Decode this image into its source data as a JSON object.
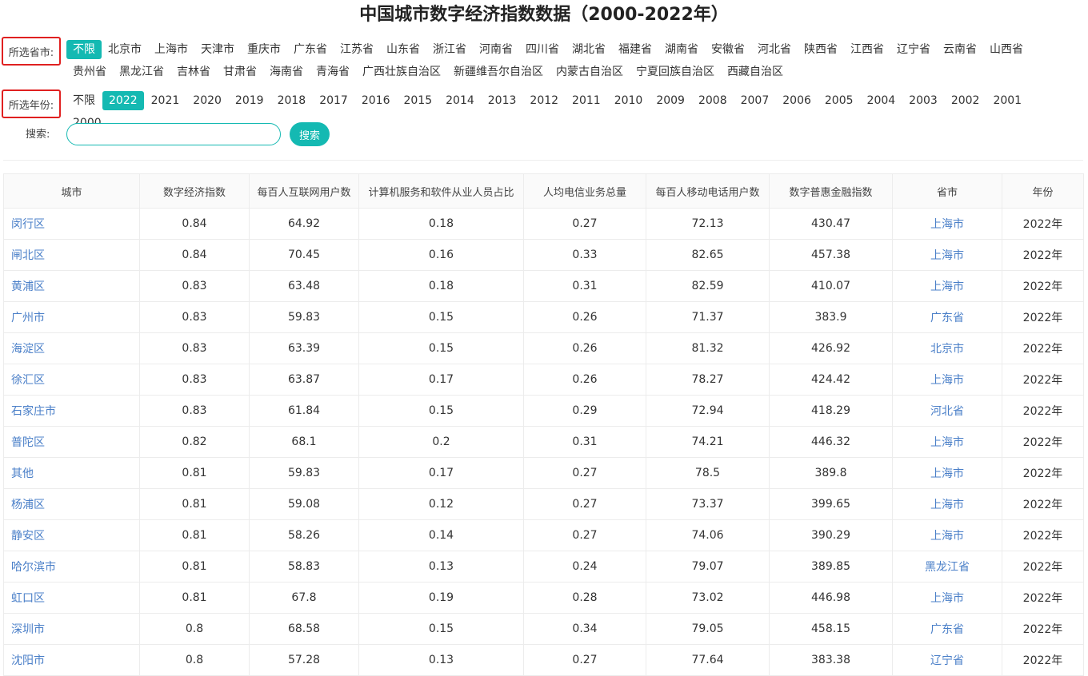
{
  "title": "中国城市数字经济指数数据（2000-2022年）",
  "province_filter": {
    "label": "所选省市:",
    "options": [
      "不限",
      "北京市",
      "上海市",
      "天津市",
      "重庆市",
      "广东省",
      "江苏省",
      "山东省",
      "浙江省",
      "河南省",
      "四川省",
      "湖北省",
      "福建省",
      "湖南省",
      "安徽省",
      "河北省",
      "陕西省",
      "江西省",
      "辽宁省",
      "云南省",
      "山西省",
      "贵州省",
      "黑龙江省",
      "吉林省",
      "甘肃省",
      "海南省",
      "青海省",
      "广西壮族自治区",
      "新疆维吾尔自治区",
      "内蒙古自治区",
      "宁夏回族自治区",
      "西藏自治区"
    ],
    "selected": "不限"
  },
  "year_filter": {
    "label": "所选年份:",
    "options": [
      "不限",
      "2022",
      "2021",
      "2020",
      "2019",
      "2018",
      "2017",
      "2016",
      "2015",
      "2014",
      "2013",
      "2012",
      "2011",
      "2010",
      "2009",
      "2008",
      "2007",
      "2006",
      "2005",
      "2004",
      "2003",
      "2002",
      "2001",
      "2000"
    ],
    "selected": "2022"
  },
  "search": {
    "label": "搜索:",
    "value": "",
    "button_label": "搜索"
  },
  "table": {
    "headers": [
      "城市",
      "数字经济指数",
      "每百人互联网用户数",
      "计算机服务和软件从业人员占比",
      "人均电信业务总量",
      "每百人移动电话用户数",
      "数字普惠金融指数",
      "省市",
      "年份"
    ],
    "rows": [
      [
        "闵行区",
        "0.84",
        "64.92",
        "0.18",
        "0.27",
        "72.13",
        "430.47",
        "上海市",
        "2022年"
      ],
      [
        "闸北区",
        "0.84",
        "70.45",
        "0.16",
        "0.33",
        "82.65",
        "457.38",
        "上海市",
        "2022年"
      ],
      [
        "黄浦区",
        "0.83",
        "63.48",
        "0.18",
        "0.31",
        "82.59",
        "410.07",
        "上海市",
        "2022年"
      ],
      [
        "广州市",
        "0.83",
        "59.83",
        "0.15",
        "0.26",
        "71.37",
        "383.9",
        "广东省",
        "2022年"
      ],
      [
        "海淀区",
        "0.83",
        "63.39",
        "0.15",
        "0.26",
        "81.32",
        "426.92",
        "北京市",
        "2022年"
      ],
      [
        "徐汇区",
        "0.83",
        "63.87",
        "0.17",
        "0.26",
        "78.27",
        "424.42",
        "上海市",
        "2022年"
      ],
      [
        "石家庄市",
        "0.83",
        "61.84",
        "0.15",
        "0.29",
        "72.94",
        "418.29",
        "河北省",
        "2022年"
      ],
      [
        "普陀区",
        "0.82",
        "68.1",
        "0.2",
        "0.31",
        "74.21",
        "446.32",
        "上海市",
        "2022年"
      ],
      [
        "其他",
        "0.81",
        "59.83",
        "0.17",
        "0.27",
        "78.5",
        "389.8",
        "上海市",
        "2022年"
      ],
      [
        "杨浦区",
        "0.81",
        "59.08",
        "0.12",
        "0.27",
        "73.37",
        "399.65",
        "上海市",
        "2022年"
      ],
      [
        "静安区",
        "0.81",
        "58.26",
        "0.14",
        "0.27",
        "74.06",
        "390.29",
        "上海市",
        "2022年"
      ],
      [
        "哈尔滨市",
        "0.81",
        "58.83",
        "0.13",
        "0.24",
        "79.07",
        "389.85",
        "黑龙江省",
        "2022年"
      ],
      [
        "虹口区",
        "0.81",
        "67.8",
        "0.19",
        "0.28",
        "73.02",
        "446.98",
        "上海市",
        "2022年"
      ],
      [
        "深圳市",
        "0.8",
        "68.58",
        "0.15",
        "0.34",
        "79.05",
        "458.15",
        "广东省",
        "2022年"
      ],
      [
        "沈阳市",
        "0.8",
        "57.28",
        "0.13",
        "0.27",
        "77.64",
        "383.38",
        "辽宁省",
        "2022年"
      ]
    ]
  },
  "colors": {
    "accent": "#14b9b2",
    "link": "#4a7fc8",
    "label_border": "#e02020"
  }
}
